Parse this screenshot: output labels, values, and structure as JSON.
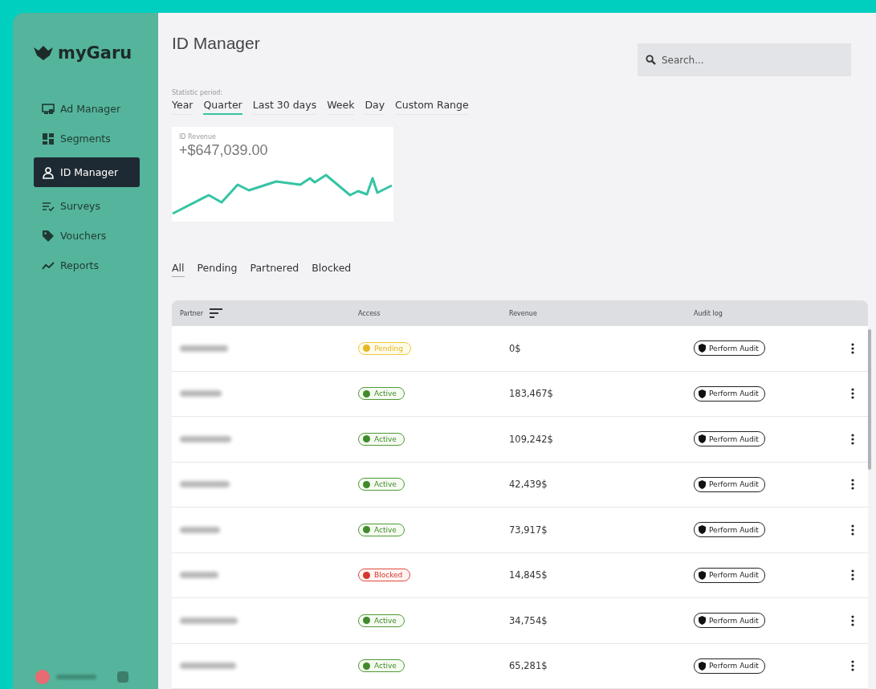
{
  "brand": {
    "name": "myGaru"
  },
  "sidebar": {
    "items": [
      {
        "label": "Ad Manager",
        "selected": false
      },
      {
        "label": "Segments",
        "selected": false
      },
      {
        "label": "ID Manager",
        "selected": true
      },
      {
        "label": "Surveys",
        "selected": false
      },
      {
        "label": "Vouchers",
        "selected": false
      },
      {
        "label": "Reports",
        "selected": false
      }
    ]
  },
  "page": {
    "title": "ID Manager"
  },
  "search": {
    "placeholder": "Search..."
  },
  "period": {
    "label": "Statistic period:",
    "tabs": [
      {
        "label": "Year",
        "selected": false
      },
      {
        "label": "Quarter",
        "selected": true
      },
      {
        "label": "Last 30 days",
        "selected": false
      },
      {
        "label": "Week",
        "selected": false
      },
      {
        "label": "Day",
        "selected": false
      },
      {
        "label": "Custom Range",
        "selected": false
      }
    ]
  },
  "revenue_card": {
    "label": "ID Revenue",
    "value": "+$647,039.00"
  },
  "filter_tabs": [
    {
      "label": "All",
      "selected": true
    },
    {
      "label": "Pending",
      "selected": false
    },
    {
      "label": "Partnered",
      "selected": false
    },
    {
      "label": "Blocked",
      "selected": false
    }
  ],
  "table": {
    "columns": [
      "Partner",
      "Access",
      "Revenue",
      "Audit log"
    ],
    "rows": [
      {
        "access": {
          "kind": "pending",
          "label": "Pending"
        },
        "revenue": "0$",
        "action": "Perform Audit"
      },
      {
        "access": {
          "kind": "active",
          "label": "Active"
        },
        "revenue": "183,467$",
        "action": "Perform Audit"
      },
      {
        "access": {
          "kind": "active",
          "label": "Active"
        },
        "revenue": "109,242$",
        "action": "Perform Audit"
      },
      {
        "access": {
          "kind": "active",
          "label": "Active"
        },
        "revenue": "42,439$",
        "action": "Perform Audit"
      },
      {
        "access": {
          "kind": "active",
          "label": "Active"
        },
        "revenue": "73,917$",
        "action": "Perform Audit"
      },
      {
        "access": {
          "kind": "blocked",
          "label": "Blocked"
        },
        "revenue": "14,845$",
        "action": "Perform Audit"
      },
      {
        "access": {
          "kind": "active",
          "label": "Active"
        },
        "revenue": "34,754$",
        "action": "Perform Audit"
      },
      {
        "access": {
          "kind": "active",
          "label": "Active"
        },
        "revenue": "65,281$",
        "action": "Perform Audit"
      }
    ]
  }
}
